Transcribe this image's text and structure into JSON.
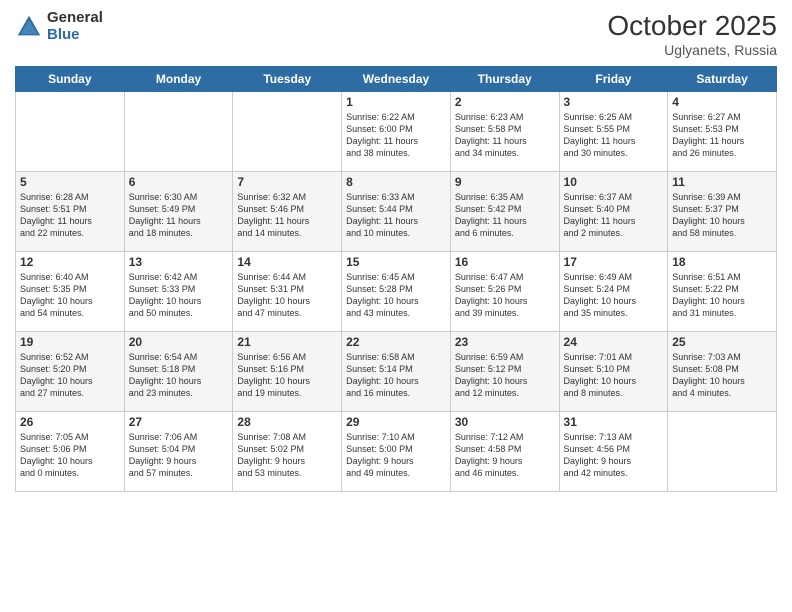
{
  "header": {
    "logo_general": "General",
    "logo_blue": "Blue",
    "month_title": "October 2025",
    "location": "Uglyanets, Russia"
  },
  "days_of_week": [
    "Sunday",
    "Monday",
    "Tuesday",
    "Wednesday",
    "Thursday",
    "Friday",
    "Saturday"
  ],
  "weeks": [
    [
      {
        "day": "",
        "info": ""
      },
      {
        "day": "",
        "info": ""
      },
      {
        "day": "",
        "info": ""
      },
      {
        "day": "1",
        "info": "Sunrise: 6:22 AM\nSunset: 6:00 PM\nDaylight: 11 hours\nand 38 minutes."
      },
      {
        "day": "2",
        "info": "Sunrise: 6:23 AM\nSunset: 5:58 PM\nDaylight: 11 hours\nand 34 minutes."
      },
      {
        "day": "3",
        "info": "Sunrise: 6:25 AM\nSunset: 5:55 PM\nDaylight: 11 hours\nand 30 minutes."
      },
      {
        "day": "4",
        "info": "Sunrise: 6:27 AM\nSunset: 5:53 PM\nDaylight: 11 hours\nand 26 minutes."
      }
    ],
    [
      {
        "day": "5",
        "info": "Sunrise: 6:28 AM\nSunset: 5:51 PM\nDaylight: 11 hours\nand 22 minutes."
      },
      {
        "day": "6",
        "info": "Sunrise: 6:30 AM\nSunset: 5:49 PM\nDaylight: 11 hours\nand 18 minutes."
      },
      {
        "day": "7",
        "info": "Sunrise: 6:32 AM\nSunset: 5:46 PM\nDaylight: 11 hours\nand 14 minutes."
      },
      {
        "day": "8",
        "info": "Sunrise: 6:33 AM\nSunset: 5:44 PM\nDaylight: 11 hours\nand 10 minutes."
      },
      {
        "day": "9",
        "info": "Sunrise: 6:35 AM\nSunset: 5:42 PM\nDaylight: 11 hours\nand 6 minutes."
      },
      {
        "day": "10",
        "info": "Sunrise: 6:37 AM\nSunset: 5:40 PM\nDaylight: 11 hours\nand 2 minutes."
      },
      {
        "day": "11",
        "info": "Sunrise: 6:39 AM\nSunset: 5:37 PM\nDaylight: 10 hours\nand 58 minutes."
      }
    ],
    [
      {
        "day": "12",
        "info": "Sunrise: 6:40 AM\nSunset: 5:35 PM\nDaylight: 10 hours\nand 54 minutes."
      },
      {
        "day": "13",
        "info": "Sunrise: 6:42 AM\nSunset: 5:33 PM\nDaylight: 10 hours\nand 50 minutes."
      },
      {
        "day": "14",
        "info": "Sunrise: 6:44 AM\nSunset: 5:31 PM\nDaylight: 10 hours\nand 47 minutes."
      },
      {
        "day": "15",
        "info": "Sunrise: 6:45 AM\nSunset: 5:28 PM\nDaylight: 10 hours\nand 43 minutes."
      },
      {
        "day": "16",
        "info": "Sunrise: 6:47 AM\nSunset: 5:26 PM\nDaylight: 10 hours\nand 39 minutes."
      },
      {
        "day": "17",
        "info": "Sunrise: 6:49 AM\nSunset: 5:24 PM\nDaylight: 10 hours\nand 35 minutes."
      },
      {
        "day": "18",
        "info": "Sunrise: 6:51 AM\nSunset: 5:22 PM\nDaylight: 10 hours\nand 31 minutes."
      }
    ],
    [
      {
        "day": "19",
        "info": "Sunrise: 6:52 AM\nSunset: 5:20 PM\nDaylight: 10 hours\nand 27 minutes."
      },
      {
        "day": "20",
        "info": "Sunrise: 6:54 AM\nSunset: 5:18 PM\nDaylight: 10 hours\nand 23 minutes."
      },
      {
        "day": "21",
        "info": "Sunrise: 6:56 AM\nSunset: 5:16 PM\nDaylight: 10 hours\nand 19 minutes."
      },
      {
        "day": "22",
        "info": "Sunrise: 6:58 AM\nSunset: 5:14 PM\nDaylight: 10 hours\nand 16 minutes."
      },
      {
        "day": "23",
        "info": "Sunrise: 6:59 AM\nSunset: 5:12 PM\nDaylight: 10 hours\nand 12 minutes."
      },
      {
        "day": "24",
        "info": "Sunrise: 7:01 AM\nSunset: 5:10 PM\nDaylight: 10 hours\nand 8 minutes."
      },
      {
        "day": "25",
        "info": "Sunrise: 7:03 AM\nSunset: 5:08 PM\nDaylight: 10 hours\nand 4 minutes."
      }
    ],
    [
      {
        "day": "26",
        "info": "Sunrise: 7:05 AM\nSunset: 5:06 PM\nDaylight: 10 hours\nand 0 minutes."
      },
      {
        "day": "27",
        "info": "Sunrise: 7:06 AM\nSunset: 5:04 PM\nDaylight: 9 hours\nand 57 minutes."
      },
      {
        "day": "28",
        "info": "Sunrise: 7:08 AM\nSunset: 5:02 PM\nDaylight: 9 hours\nand 53 minutes."
      },
      {
        "day": "29",
        "info": "Sunrise: 7:10 AM\nSunset: 5:00 PM\nDaylight: 9 hours\nand 49 minutes."
      },
      {
        "day": "30",
        "info": "Sunrise: 7:12 AM\nSunset: 4:58 PM\nDaylight: 9 hours\nand 46 minutes."
      },
      {
        "day": "31",
        "info": "Sunrise: 7:13 AM\nSunset: 4:56 PM\nDaylight: 9 hours\nand 42 minutes."
      },
      {
        "day": "",
        "info": ""
      }
    ]
  ]
}
